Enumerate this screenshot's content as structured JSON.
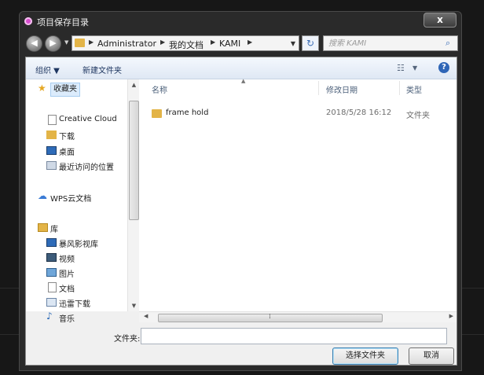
{
  "dialog": {
    "title": "项目保存目录",
    "close_label": "x"
  },
  "nav": {
    "back_icon": "back-arrow-icon",
    "forward_icon": "forward-arrow-icon",
    "breadcrumb": [
      "Administrator",
      "我的文档",
      "KAMI"
    ],
    "search_placeholder": "搜索 KAMI"
  },
  "toolbar": {
    "organize_label": "组织 ▼",
    "new_folder_label": "新建文件夹"
  },
  "sidebar": {
    "favorites": {
      "label": "收藏夹",
      "icon": "star-icon"
    },
    "favorite_items": [
      {
        "label": "Creative Cloud",
        "icon": "document-icon"
      },
      {
        "label": "下载",
        "icon": "download-folder-icon"
      },
      {
        "label": "桌面",
        "icon": "desktop-icon"
      },
      {
        "label": "最近访问的位置",
        "icon": "recent-places-icon"
      }
    ],
    "wps": {
      "label": "WPS云文档",
      "icon": "cloud-icon"
    },
    "library": {
      "label": "库",
      "icon": "library-icon"
    },
    "library_items": [
      {
        "label": "暴风影视库",
        "icon": "video-library-icon"
      },
      {
        "label": "视频",
        "icon": "video-icon"
      },
      {
        "label": "图片",
        "icon": "picture-icon"
      },
      {
        "label": "文档",
        "icon": "document-icon"
      },
      {
        "label": "迅雷下载",
        "icon": "download-icon"
      },
      {
        "label": "音乐",
        "icon": "music-icon"
      }
    ]
  },
  "file_list": {
    "columns": [
      "名称",
      "修改日期",
      "类型"
    ],
    "rows": [
      {
        "name": "frame hold",
        "date": "2018/5/28 16:12",
        "type": "文件夹"
      }
    ]
  },
  "footer": {
    "folder_label": "文件夹:",
    "folder_value": "",
    "select_button": "选择文件夹",
    "cancel_button": "取消"
  },
  "colors": {
    "background": "#171717",
    "titlebar": "#2a2a2a",
    "accent": "#3c7fb1",
    "folder": "#e3b447"
  }
}
